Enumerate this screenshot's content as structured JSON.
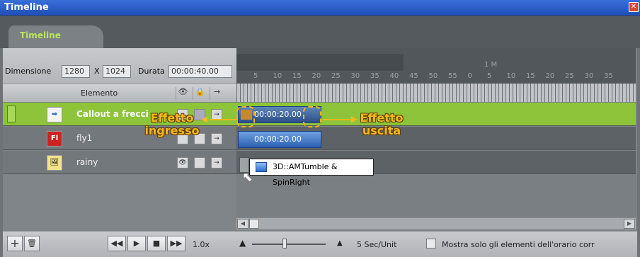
{
  "window": {
    "title": "Timeline",
    "close_icon": "close-icon"
  },
  "tab": {
    "label": "Timeline"
  },
  "settings": {
    "dimension_label": "Dimensione",
    "width": "1280",
    "x_label": "X",
    "height": "1024",
    "duration_label": "Durata",
    "duration": "00:00:40.00"
  },
  "ruler": {
    "minute_label": "1 M",
    "seconds": [
      "5",
      "10",
      "15",
      "20",
      "25",
      "30",
      "35",
      "40",
      "45",
      "50",
      "55",
      "0",
      "5",
      "10",
      "15",
      "20",
      "25",
      "30",
      "35"
    ]
  },
  "columns": {
    "element": "Elemento"
  },
  "rows": [
    {
      "name": "Callout a frecci",
      "clip_time": "00:00:20.00"
    },
    {
      "name": "fly1",
      "clip_time": "00:00:20.00"
    },
    {
      "name": "rainy",
      "clip_time": ""
    }
  ],
  "annotations": {
    "entry": "Effetto\ningresso",
    "exit": "Effetto\nuscita"
  },
  "tooltip": {
    "text": "3D::AMTumble & SpinRight"
  },
  "bottom": {
    "speed": "1.0x",
    "unit": "5 Sec/Unit",
    "checkbox_label": "Mostra solo gli elementi dell'orario corr"
  },
  "colors": {
    "accent_green": "#8dc43a",
    "title_blue": "#2a5fcf",
    "annotation_orange": "#f6b81e"
  }
}
